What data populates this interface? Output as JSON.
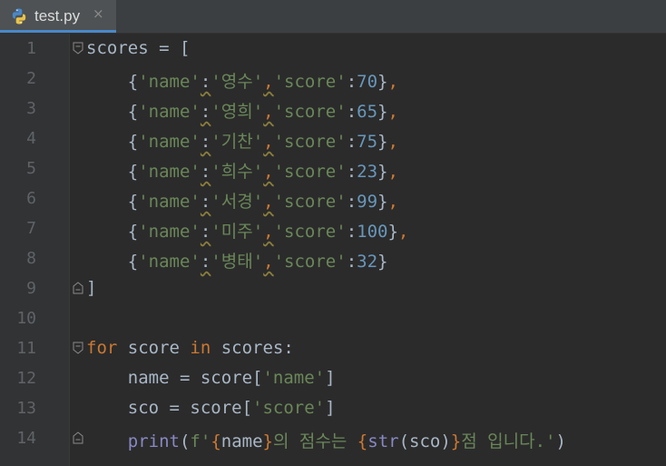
{
  "tab": {
    "label": "test.py",
    "close": "×",
    "icon": "python-file-icon"
  },
  "lines": [
    {
      "num": "1",
      "indent": "",
      "parts": [
        [
          "txt",
          "scores = ["
        ]
      ]
    },
    {
      "num": "2",
      "indent": "    ",
      "parts": [
        [
          "txt",
          "{"
        ],
        [
          "str",
          "'name'"
        ],
        [
          "txt",
          ":"
        ],
        [
          "str",
          "'영수'"
        ],
        [
          "kw",
          ","
        ],
        [
          "str",
          "'score'"
        ],
        [
          "txt",
          ":"
        ],
        [
          "num",
          "70"
        ],
        [
          "txt",
          "}"
        ],
        [
          "kw",
          ","
        ]
      ]
    },
    {
      "num": "3",
      "indent": "    ",
      "parts": [
        [
          "txt",
          "{"
        ],
        [
          "str",
          "'name'"
        ],
        [
          "txt",
          ":"
        ],
        [
          "str",
          "'영희'"
        ],
        [
          "kw",
          ","
        ],
        [
          "str",
          "'score'"
        ],
        [
          "txt",
          ":"
        ],
        [
          "num",
          "65"
        ],
        [
          "txt",
          "}"
        ],
        [
          "kw",
          ","
        ]
      ]
    },
    {
      "num": "4",
      "indent": "    ",
      "parts": [
        [
          "txt",
          "{"
        ],
        [
          "str",
          "'name'"
        ],
        [
          "txt",
          ":"
        ],
        [
          "str",
          "'기찬'"
        ],
        [
          "kw",
          ","
        ],
        [
          "str",
          "'score'"
        ],
        [
          "txt",
          ":"
        ],
        [
          "num",
          "75"
        ],
        [
          "txt",
          "}"
        ],
        [
          "kw",
          ","
        ]
      ]
    },
    {
      "num": "5",
      "indent": "    ",
      "parts": [
        [
          "txt",
          "{"
        ],
        [
          "str",
          "'name'"
        ],
        [
          "txt",
          ":"
        ],
        [
          "str",
          "'희수'"
        ],
        [
          "kw",
          ","
        ],
        [
          "str",
          "'score'"
        ],
        [
          "txt",
          ":"
        ],
        [
          "num",
          "23"
        ],
        [
          "txt",
          "}"
        ],
        [
          "kw",
          ","
        ]
      ]
    },
    {
      "num": "6",
      "indent": "    ",
      "parts": [
        [
          "txt",
          "{"
        ],
        [
          "str",
          "'name'"
        ],
        [
          "txt",
          ":"
        ],
        [
          "str",
          "'서경'"
        ],
        [
          "kw",
          ","
        ],
        [
          "str",
          "'score'"
        ],
        [
          "txt",
          ":"
        ],
        [
          "num",
          "99"
        ],
        [
          "txt",
          "}"
        ],
        [
          "kw",
          ","
        ]
      ]
    },
    {
      "num": "7",
      "indent": "    ",
      "parts": [
        [
          "txt",
          "{"
        ],
        [
          "str",
          "'name'"
        ],
        [
          "txt",
          ":"
        ],
        [
          "str",
          "'미주'"
        ],
        [
          "kw",
          ","
        ],
        [
          "str",
          "'score'"
        ],
        [
          "txt",
          ":"
        ],
        [
          "num",
          "100"
        ],
        [
          "txt",
          "}"
        ],
        [
          "kw",
          ","
        ]
      ]
    },
    {
      "num": "8",
      "indent": "    ",
      "parts": [
        [
          "txt",
          "{"
        ],
        [
          "str",
          "'name'"
        ],
        [
          "txt",
          ":"
        ],
        [
          "str",
          "'병태'"
        ],
        [
          "kw",
          ","
        ],
        [
          "str",
          "'score'"
        ],
        [
          "txt",
          ":"
        ],
        [
          "num",
          "32"
        ],
        [
          "txt",
          "}"
        ]
      ]
    },
    {
      "num": "9",
      "indent": "",
      "parts": [
        [
          "txt",
          "]"
        ]
      ]
    },
    {
      "num": "10",
      "indent": "",
      "parts": []
    },
    {
      "num": "11",
      "indent": "",
      "parts": [
        [
          "kw",
          "for"
        ],
        [
          "txt",
          " score "
        ],
        [
          "kw",
          "in"
        ],
        [
          "txt",
          " scores:"
        ]
      ]
    },
    {
      "num": "12",
      "indent": "    ",
      "parts": [
        [
          "txt",
          "name = score["
        ],
        [
          "str",
          "'name'"
        ],
        [
          "txt",
          "]"
        ]
      ]
    },
    {
      "num": "13",
      "indent": "    ",
      "parts": [
        [
          "txt",
          "sco = score["
        ],
        [
          "str",
          "'score'"
        ],
        [
          "txt",
          "]"
        ]
      ]
    },
    {
      "num": "14",
      "indent": "    ",
      "parts": [
        [
          "bi",
          "print"
        ],
        [
          "txt",
          "("
        ],
        [
          "str",
          "f'"
        ],
        [
          "brace",
          "{"
        ],
        [
          "txt",
          "name"
        ],
        [
          "brace",
          "}"
        ],
        [
          "str",
          "의 점수는 "
        ],
        [
          "brace",
          "{"
        ],
        [
          "bi",
          "str"
        ],
        [
          "txt",
          "(sco)"
        ],
        [
          "brace",
          "}"
        ],
        [
          "str",
          "점 입니다.'"
        ],
        [
          "txt",
          ")"
        ]
      ]
    }
  ],
  "folds": {
    "1": "open",
    "9": "close",
    "11": "open",
    "14": "close"
  },
  "colors": {
    "keyword": "#cc7832",
    "string": "#6a8759",
    "number": "#6897bb",
    "builtin": "#8888c6",
    "text": "#a9b7c6"
  }
}
